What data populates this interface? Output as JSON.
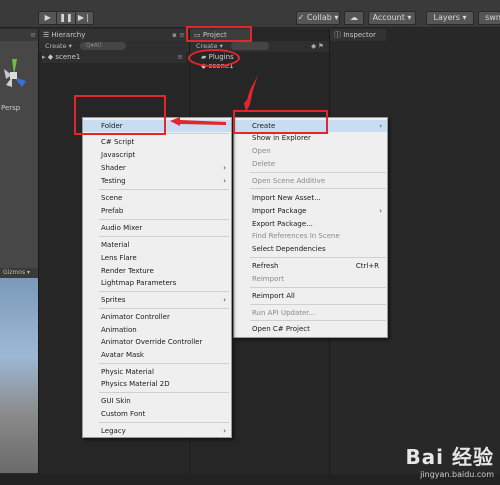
{
  "toolbar": {
    "play": "▶",
    "pause": "❚❚",
    "step": "▶❘",
    "collab": "✓ Collab ▾",
    "cloud": "☁",
    "account": "Account ▾",
    "layers": "Layers ▾",
    "layout": "swn"
  },
  "scene": {
    "persp": "Persp",
    "gizmos": "Gizmos ▾"
  },
  "hierarchy": {
    "tab": "Hierarchy",
    "create": "Create ▾",
    "search": "Q▾All",
    "scene_name": "scene1"
  },
  "project": {
    "tab": "Project",
    "create": "Create ▾",
    "items": [
      "Plugins",
      "scene1"
    ]
  },
  "inspector": {
    "tab": "Inspector"
  },
  "context_menu": {
    "items": [
      {
        "label": "Create",
        "arrow": "›"
      },
      {
        "label": "Show in Explorer"
      },
      {
        "label": "Open"
      },
      {
        "label": "Delete"
      },
      {
        "label": "Open Scene Additive"
      },
      {
        "label": "Import New Asset..."
      },
      {
        "label": "Import Package",
        "arrow": "›"
      },
      {
        "label": "Export Package..."
      },
      {
        "label": "Find References In Scene"
      },
      {
        "label": "Select Dependencies"
      },
      {
        "label": "Refresh",
        "shortcut": "Ctrl+R"
      },
      {
        "label": "Reimport"
      },
      {
        "label": "Reimport All"
      },
      {
        "label": "Run API Updater..."
      },
      {
        "label": "Open C# Project"
      }
    ]
  },
  "create_menu": {
    "items": [
      {
        "label": "Folder"
      },
      {
        "label": "C# Script"
      },
      {
        "label": "Javascript"
      },
      {
        "label": "Shader",
        "arrow": "›"
      },
      {
        "label": "Testing",
        "arrow": "›"
      },
      {
        "label": "Scene"
      },
      {
        "label": "Prefab"
      },
      {
        "label": "Audio Mixer"
      },
      {
        "label": "Material"
      },
      {
        "label": "Lens Flare"
      },
      {
        "label": "Render Texture"
      },
      {
        "label": "Lightmap Parameters"
      },
      {
        "label": "Sprites",
        "arrow": "›"
      },
      {
        "label": "Animator Controller"
      },
      {
        "label": "Animation"
      },
      {
        "label": "Animator Override Controller"
      },
      {
        "label": "Avatar Mask"
      },
      {
        "label": "Physic Material"
      },
      {
        "label": "Physics Material 2D"
      },
      {
        "label": "GUI Skin"
      },
      {
        "label": "Custom Font"
      },
      {
        "label": "Legacy",
        "arrow": "›"
      }
    ]
  },
  "watermark": {
    "logo": "Bai 经验",
    "url": "jingyan.baidu.com"
  },
  "colors": {
    "highlight": "#c9ddf2",
    "annotation": "#e3262a"
  }
}
